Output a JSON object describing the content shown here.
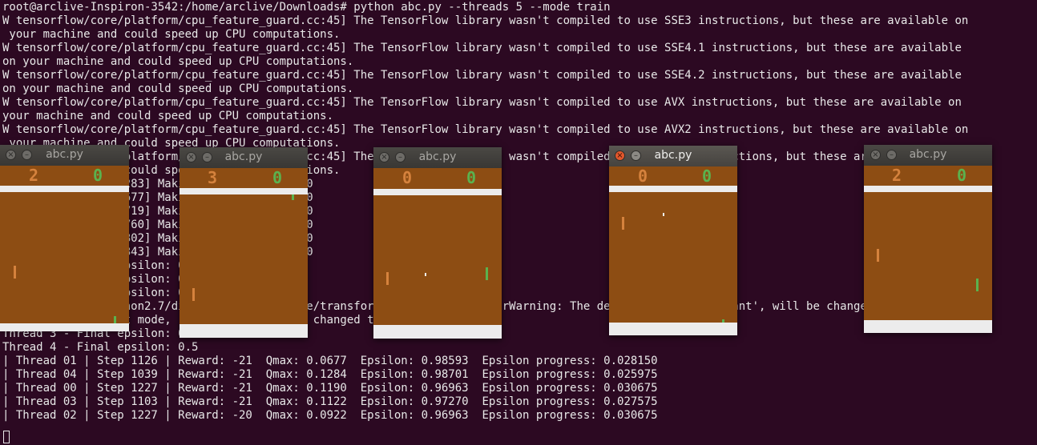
{
  "terminal": {
    "lines": [
      "root@arclive-Inspiron-3542:/home/arclive/Downloads# python abc.py --threads 5 --mode train",
      "W tensorflow/core/platform/cpu_feature_guard.cc:45] The TensorFlow library wasn't compiled to use SSE3 instructions, but these are available on",
      " your machine and could speed up CPU computations.",
      "W tensorflow/core/platform/cpu_feature_guard.cc:45] The TensorFlow library wasn't compiled to use SSE4.1 instructions, but these are available",
      "on your machine and could speed up CPU computations.",
      "W tensorflow/core/platform/cpu_feature_guard.cc:45] The TensorFlow library wasn't compiled to use SSE4.2 instructions, but these are available",
      "on your machine and could speed up CPU computations.",
      "W tensorflow/core/platform/cpu_feature_guard.cc:45] The TensorFlow library wasn't compiled to use AVX instructions, but these are available on",
      "your machine and could speed up CPU computations.",
      "W tensorflow/core/platform/cpu_feature_guard.cc:45] The TensorFlow library wasn't compiled to use AVX2 instructions, but these are available on",
      " your machine and could speed up CPU computations.",
      "W tensorflow/core/platform/cpu_feature_guard.cc:45] The TensorFlow library wasn't compiled to use FMA instructions, but these are available on",
      " your machine and could speed up CPU computations.",
      "[2017-04-05 16:24,283] Making new env: Pong-v0",
      "[2017-04-05 16:24,677] Making new env: Pong-v0",
      "[2017-04-05 16:24,719] Making new env: Pong-v0",
      "[2017-04-05 16:24,760] Making new env: Pong-v0",
      "[2017-04-05 16:24,802] Making new env: Pong-v0",
      "[2017-04-05 16:24,843] Making new env: Pong-v0",
      "Thread 0 - Final epsilon: 0.1",
      "Thread 1 - Final epsilon: 0.01",
      "Thread 2 - Final epsilon: 0.1",
      "/usr/local/lib/python2.7/dist-packages/skimage/transform/_warps.py:84: UserWarning: The default mode, 'constant', will be changed to 'reflect'",
      "  warn(\"The default mode, 'constant', will be changed to 'reflect' in \"",
      "Thread 3 - Final epsilon: 0.01",
      "Thread 4 - Final epsilon: 0.5",
      "| Thread 01 | Step 1126 | Reward: -21  Qmax: 0.0677  Epsilon: 0.98593  Epsilon progress: 0.028150",
      "| Thread 04 | Step 1039 | Reward: -21  Qmax: 0.1284  Epsilon: 0.98701  Epsilon progress: 0.025975",
      "| Thread 00 | Step 1227 | Reward: -21  Qmax: 0.1190  Epsilon: 0.96963  Epsilon progress: 0.030675",
      "| Thread 03 | Step 1103 | Reward: -21  Qmax: 0.1122  Epsilon: 0.97270  Epsilon progress: 0.027575",
      "| Thread 02 | Step 1227 | Reward: -20  Qmax: 0.0922  Epsilon: 0.96963  Epsilon progress: 0.030675"
    ]
  },
  "windows": [
    {
      "title": "abc.py",
      "score_left": "2",
      "score_right": "0",
      "active": false
    },
    {
      "title": "abc.py",
      "score_left": "3",
      "score_right": "0",
      "active": false
    },
    {
      "title": "abc.py",
      "score_left": "0",
      "score_right": "0",
      "active": false
    },
    {
      "title": "abc.py",
      "score_left": "0",
      "score_right": "0",
      "active": true
    },
    {
      "title": "abc.py",
      "score_left": "2",
      "score_right": "0",
      "active": false
    }
  ],
  "icons": {
    "close": "×",
    "minimize": "–"
  },
  "colors": {
    "terminal_bg": "#2c0922",
    "court": "#8d4d13",
    "player_left": "#d5823d",
    "player_right": "#5bb24e"
  }
}
